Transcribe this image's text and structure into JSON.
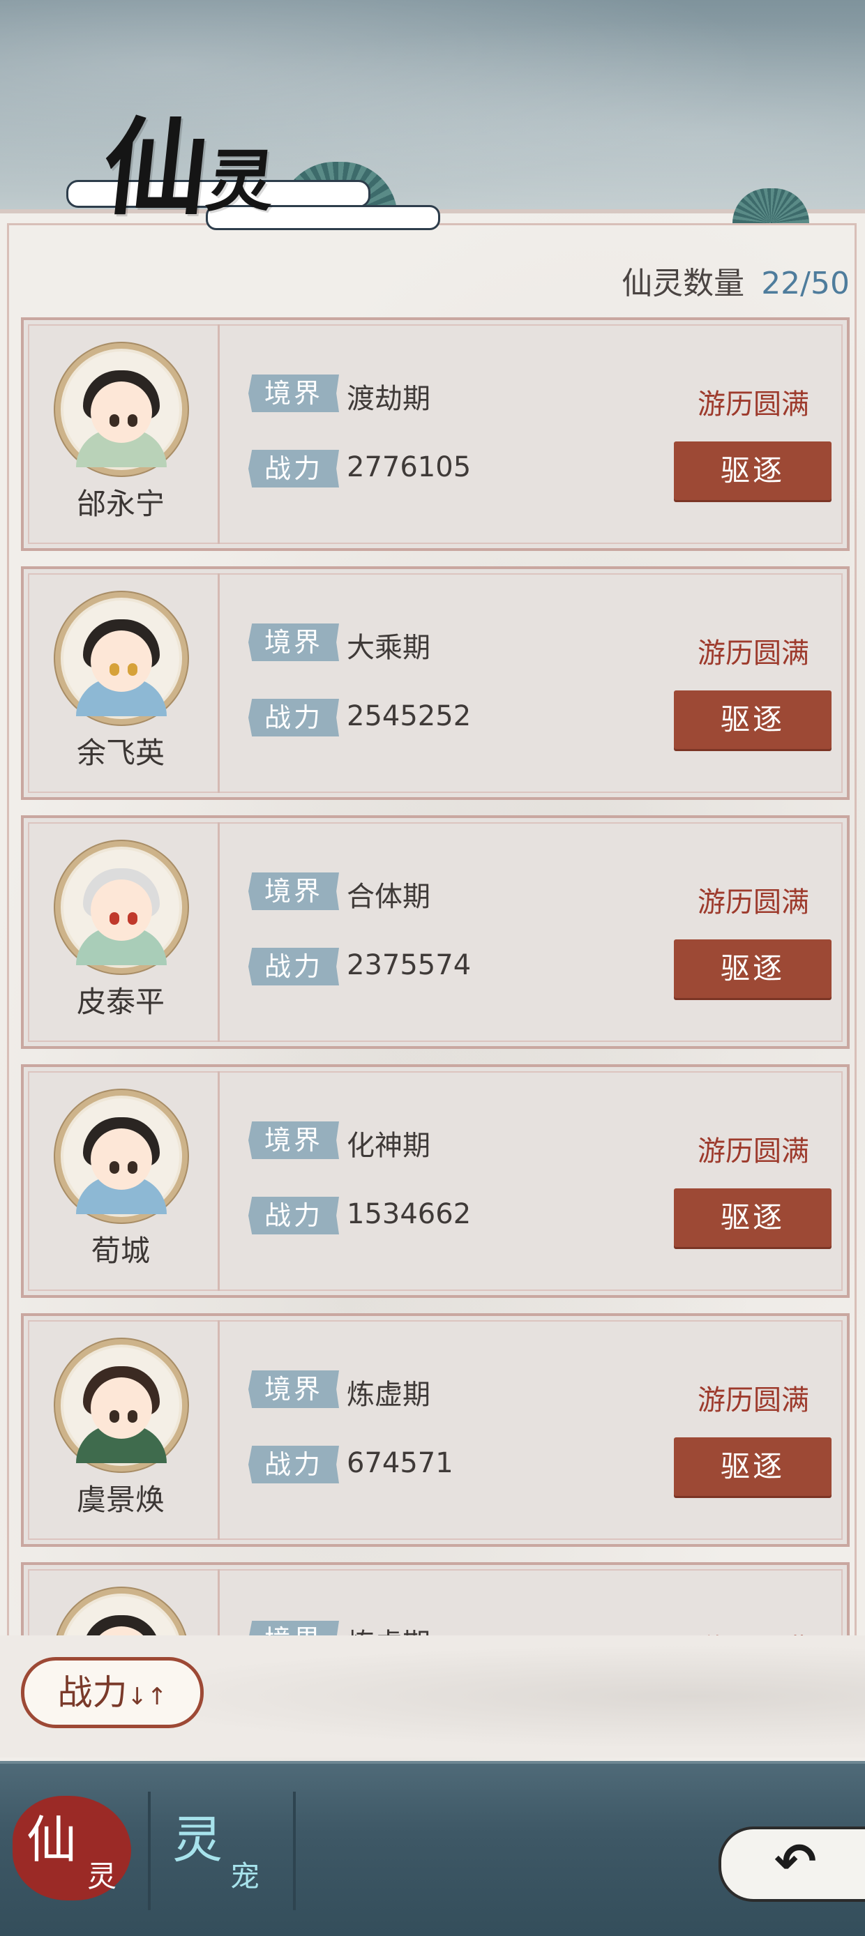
{
  "header": {
    "title_main": "仙",
    "title_sub": "灵"
  },
  "count": {
    "label": "仙灵数量",
    "value": "22/50"
  },
  "labels": {
    "realm": "境界",
    "power": "战力",
    "dismiss": "驱逐"
  },
  "spirits": [
    {
      "name": "邰永宁",
      "realm": "渡劫期",
      "power": "2776105",
      "status": "游历圆满"
    },
    {
      "name": "余飞英",
      "realm": "大乘期",
      "power": "2545252",
      "status": "游历圆满"
    },
    {
      "name": "皮泰平",
      "realm": "合体期",
      "power": "2375574",
      "status": "游历圆满"
    },
    {
      "name": "荀城",
      "realm": "化神期",
      "power": "1534662",
      "status": "游历圆满"
    },
    {
      "name": "虞景焕",
      "realm": "炼虚期",
      "power": "674571",
      "status": "游历圆满"
    },
    {
      "name": "",
      "realm": "炼虚期",
      "power": "",
      "status": "游历圆满"
    }
  ],
  "sort_button": {
    "label": "战力",
    "arrows": "↓↑"
  },
  "nav": {
    "tab_xian_big": "仙",
    "tab_xian_small": "灵",
    "tab_ling_big": "灵",
    "tab_ling_small": "宠"
  },
  "colors": {
    "accent": "#9d4935",
    "status_text": "#9d3a2c",
    "tag_bg": "#96afbd",
    "count_value": "#4e7c9c"
  },
  "icons": {
    "back": "back-arrow-icon",
    "sort": "sort-arrows-icon"
  }
}
